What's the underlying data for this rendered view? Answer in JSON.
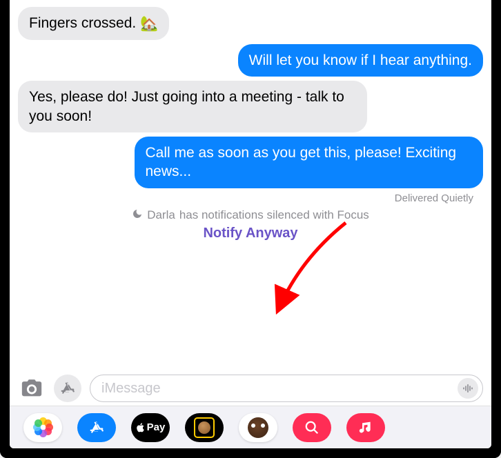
{
  "messages": [
    {
      "text": "Fingers crossed.",
      "emoji": "🏡",
      "out": false
    },
    {
      "text": "Will let you know if I hear anything.",
      "out": true
    },
    {
      "text": "Yes, please do! Just going into a meeting - talk to you soon!",
      "out": false
    },
    {
      "text": "Call me as soon as you get this, please! Exciting news...",
      "out": true
    }
  ],
  "delivery_status": "Delivered Quietly",
  "focus": {
    "contact_name": "Darla",
    "status_text": "has notifications silenced with Focus"
  },
  "notify_action": "Notify Anyway",
  "composer": {
    "placeholder": "iMessage"
  },
  "apps": {
    "pay_label": "Pay"
  }
}
